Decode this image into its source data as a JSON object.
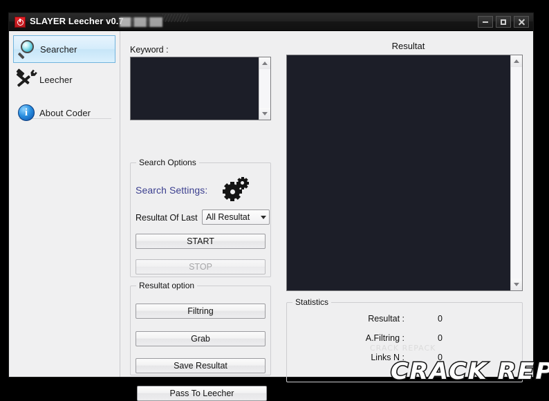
{
  "window": {
    "title": "SLAYER Leecher v0.7",
    "app_icon": "power-icon",
    "controls": {
      "minimize": "minimize-icon",
      "maximize": "maximize-icon",
      "close": "close-icon"
    }
  },
  "sidebar": {
    "items": [
      {
        "label": "Searcher",
        "icon": "magnifier-icon",
        "selected": true
      },
      {
        "label": "Leecher",
        "icon": "tools-icon",
        "selected": false
      },
      {
        "label": "About Coder",
        "icon": "info-icon",
        "selected": false
      }
    ]
  },
  "keyword": {
    "label": "Keyword :",
    "value": "",
    "placeholder": ""
  },
  "search_options": {
    "group_title": "Search Options",
    "settings_link": "Search Settings:",
    "settings_icon": "gears-icon",
    "result_of_last_label": "Resultat Of Last",
    "result_of_last_value": "All Resultat",
    "result_of_last_options": [
      "All Resultat"
    ],
    "start_label": "START",
    "stop_label": "STOP",
    "stop_disabled": true
  },
  "result_options": {
    "group_title": "Resultat option",
    "filtring_label": "Filtring",
    "grab_label": "Grab",
    "save_label": "Save Resultat"
  },
  "pass_to_leecher_label": "Pass To Leecher",
  "result_panel": {
    "title": "Resultat",
    "content": ""
  },
  "statistics": {
    "group_title": "Statistics",
    "rows": [
      {
        "label": "Resultat :",
        "value": "0"
      },
      {
        "label": "A.Filtring :",
        "value": "0"
      },
      {
        "label": "Links N :",
        "value": "0"
      }
    ]
  },
  "watermark": {
    "text": "CRACK REPACK"
  },
  "colors": {
    "accent_link": "#3b3f8f",
    "titlebar": "#1a1a1a",
    "app_icon_red": "#d42027",
    "dark_field": "#1c1e28",
    "selection_blue": "#c7e5f8",
    "window_bg": "#efeff0"
  }
}
